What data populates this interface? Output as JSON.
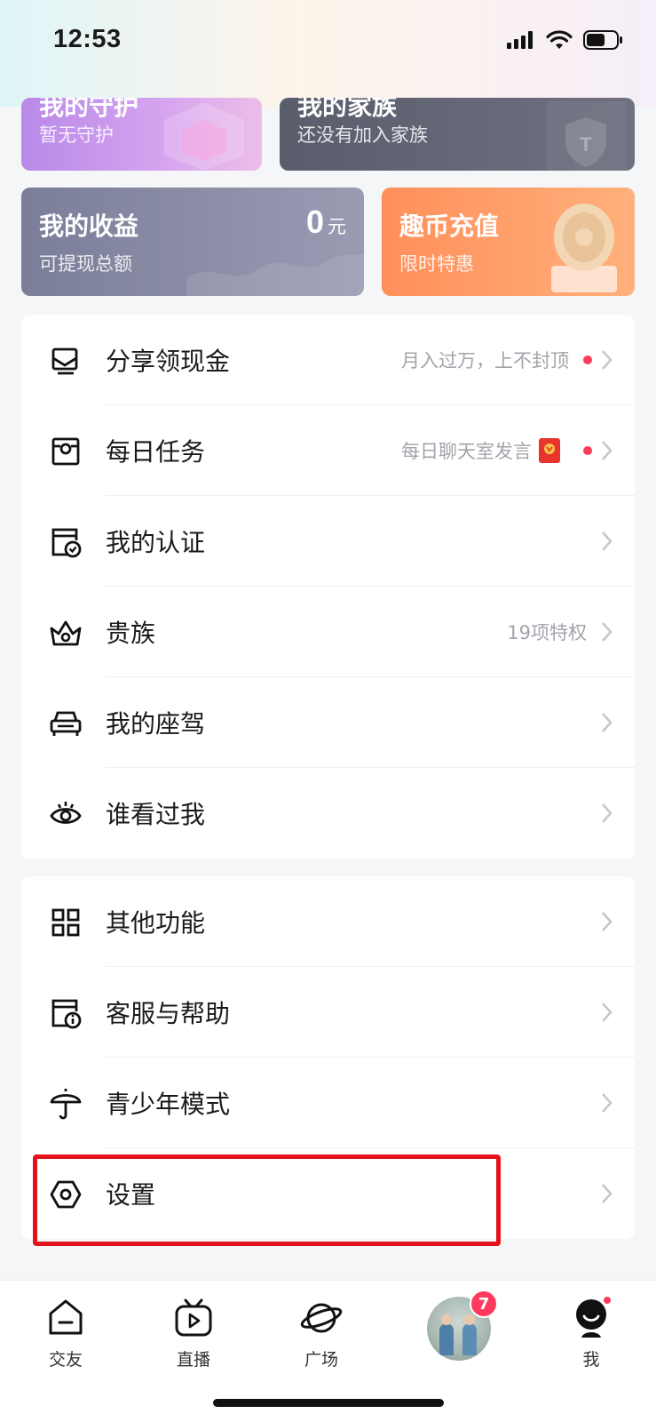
{
  "status_bar": {
    "time": "12:53"
  },
  "top_cards": {
    "guard": {
      "title": "我的守护",
      "sub": "暂无守护"
    },
    "family": {
      "title": "我的家族",
      "sub": "还没有加入家族"
    },
    "income": {
      "title": "我的收益",
      "amount": "0",
      "unit": "元",
      "sub": "可提现总额"
    },
    "recharge": {
      "title": "趣币充值",
      "sub": "限时特惠"
    }
  },
  "menu_group_1": [
    {
      "label": "分享领现金",
      "hint": "月入过万，上不封顶",
      "dot": true,
      "icon": "share-cash-icon"
    },
    {
      "label": "每日任务",
      "hint": "每日聊天室发言",
      "dot": true,
      "icon": "daily-task-icon"
    },
    {
      "label": "我的认证",
      "hint": "",
      "dot": false,
      "icon": "verify-icon"
    },
    {
      "label": "贵族",
      "hint": "19项特权",
      "dot": false,
      "icon": "crown-icon"
    },
    {
      "label": "我的座驾",
      "hint": "",
      "dot": false,
      "icon": "car-icon"
    },
    {
      "label": "谁看过我",
      "hint": "",
      "dot": false,
      "icon": "eye-icon"
    }
  ],
  "menu_group_2": [
    {
      "label": "其他功能",
      "icon": "grid-icon"
    },
    {
      "label": "客服与帮助",
      "icon": "help-icon"
    },
    {
      "label": "青少年模式",
      "icon": "umbrella-icon"
    },
    {
      "label": "设置",
      "icon": "settings-icon"
    }
  ],
  "tabbar": {
    "tabs": [
      {
        "label": "交友",
        "icon": "home-icon"
      },
      {
        "label": "直播",
        "icon": "tv-play-icon"
      },
      {
        "label": "广场",
        "icon": "planet-icon"
      },
      {
        "label": "",
        "icon": "avatar",
        "badge": "7"
      },
      {
        "label": "我",
        "icon": "profile-icon"
      }
    ]
  },
  "colors": {
    "accent_red": "#ff3b5c",
    "highlight": "#e3121b"
  }
}
